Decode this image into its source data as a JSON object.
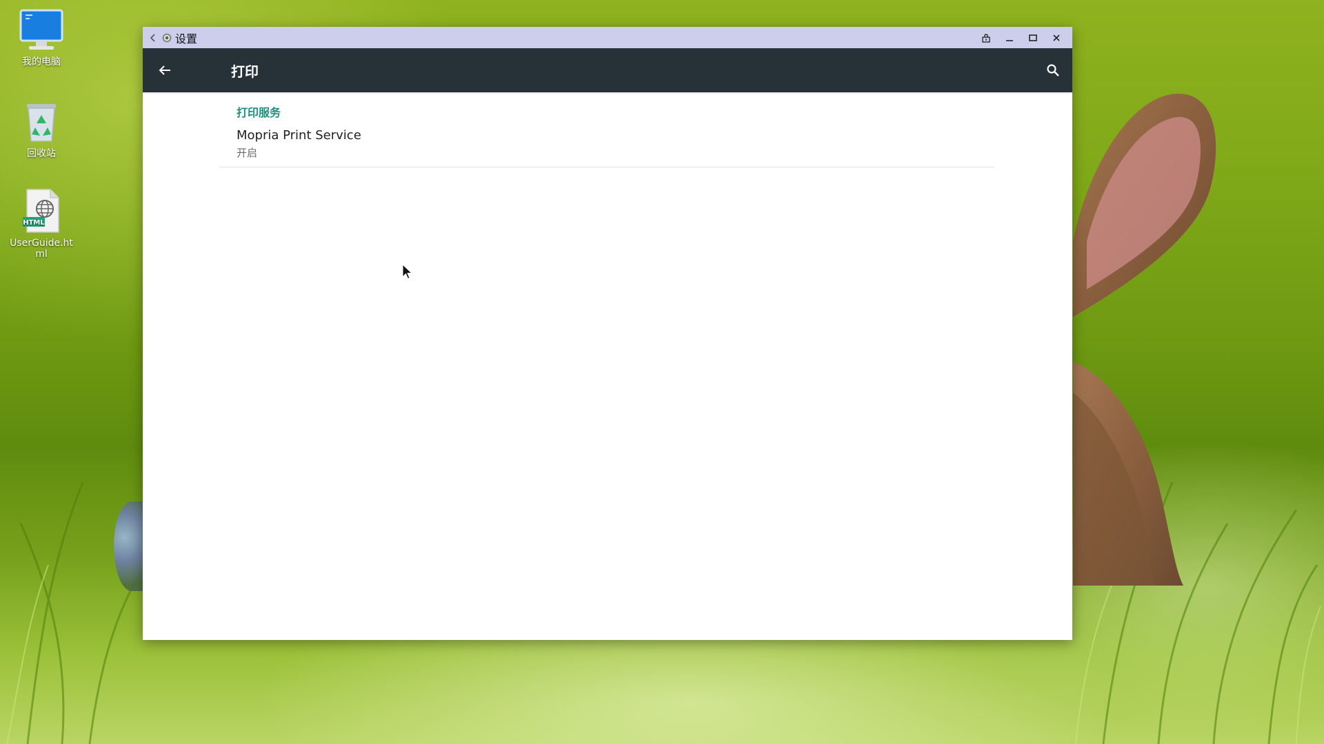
{
  "desktop": {
    "icons": [
      {
        "label": "我的电脑",
        "icon": "computer-monitor-icon"
      },
      {
        "label": "回收站",
        "icon": "recycle-bin-icon"
      },
      {
        "label": "UserGuide.html",
        "icon": "html-file-icon",
        "badge": "HTML"
      }
    ]
  },
  "window": {
    "title": "设置",
    "title_icon": "settings-gear-icon",
    "controls": [
      "pin-icon",
      "minimize-icon",
      "maximize-icon",
      "close-icon"
    ]
  },
  "appbar": {
    "title": "打印",
    "back_icon": "arrow-back-icon",
    "search_icon": "search-icon"
  },
  "content": {
    "section_header": "打印服务",
    "items": [
      {
        "title": "Mopria Print Service",
        "summary": "开启"
      }
    ]
  },
  "colors": {
    "titlebar": "#cdcdec",
    "appbar": "#263238",
    "accent": "#1e8e7e"
  }
}
